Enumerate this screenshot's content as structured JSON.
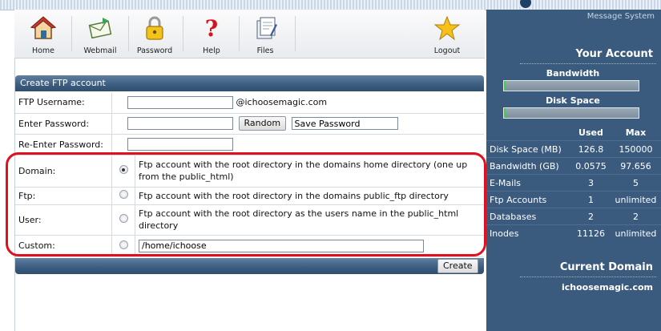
{
  "toolbar": {
    "items": [
      {
        "label": "Home",
        "icon": "house-icon"
      },
      {
        "label": "Webmail",
        "icon": "mail-icon"
      },
      {
        "label": "Password",
        "icon": "padlock-icon"
      },
      {
        "label": "Help",
        "icon": "question-icon"
      },
      {
        "label": "Files",
        "icon": "files-icon"
      },
      {
        "label": "Logout",
        "icon": "star-icon"
      }
    ]
  },
  "panel": {
    "title": "Create FTP account",
    "username_label": "FTP Username:",
    "username_value": "",
    "domain_suffix": "@ichoosemagic.com",
    "password_label": "Enter Password:",
    "password_value": "",
    "random_label": "Random",
    "save_password_value": "Save Password",
    "reenter_label": "Re-Enter Password:",
    "reenter_value": "",
    "options": [
      {
        "label": "Domain:",
        "desc": "Ftp account with the root directory in the domains home directory (one up from the public_html)",
        "selected": true
      },
      {
        "label": "Ftp:",
        "desc": "Ftp account with the root directory in the domains public_ftp directory",
        "selected": false
      },
      {
        "label": "User:",
        "desc": "Ftp account with the root directory as the users name in the public_html directory",
        "selected": false
      },
      {
        "label": "Custom:",
        "desc": "",
        "selected": false
      }
    ],
    "custom_path_value": "/home/ichoose",
    "create_label": "Create"
  },
  "right": {
    "message_system": "Message System",
    "your_account": "Your Account",
    "bandwidth_label": "Bandwidth",
    "bandwidth_usage_fraction": 0.0006,
    "disk_space_label": "Disk Space",
    "disk_usage_fraction": 0.0008,
    "stats_headers": {
      "used": "Used",
      "max": "Max"
    },
    "stats": [
      {
        "label": "Disk Space (MB)",
        "used": "126.8",
        "max": "150000"
      },
      {
        "label": "Bandwidth (GB)",
        "used": "0.0575",
        "max": "97.656"
      },
      {
        "label": "E-Mails",
        "used": "3",
        "max": "5"
      },
      {
        "label": "Ftp Accounts",
        "used": "1",
        "max": "unlimited"
      },
      {
        "label": "Databases",
        "used": "2",
        "max": "2"
      },
      {
        "label": "Inodes",
        "used": "11126",
        "max": "unlimited"
      }
    ],
    "current_domain_title": "Current Domain",
    "current_domain": "ichoosemagic.com"
  },
  "colors": {
    "accent": "#3a5a7e",
    "highlight": "#e0101e",
    "usage_fill": "#3ccf4e"
  }
}
